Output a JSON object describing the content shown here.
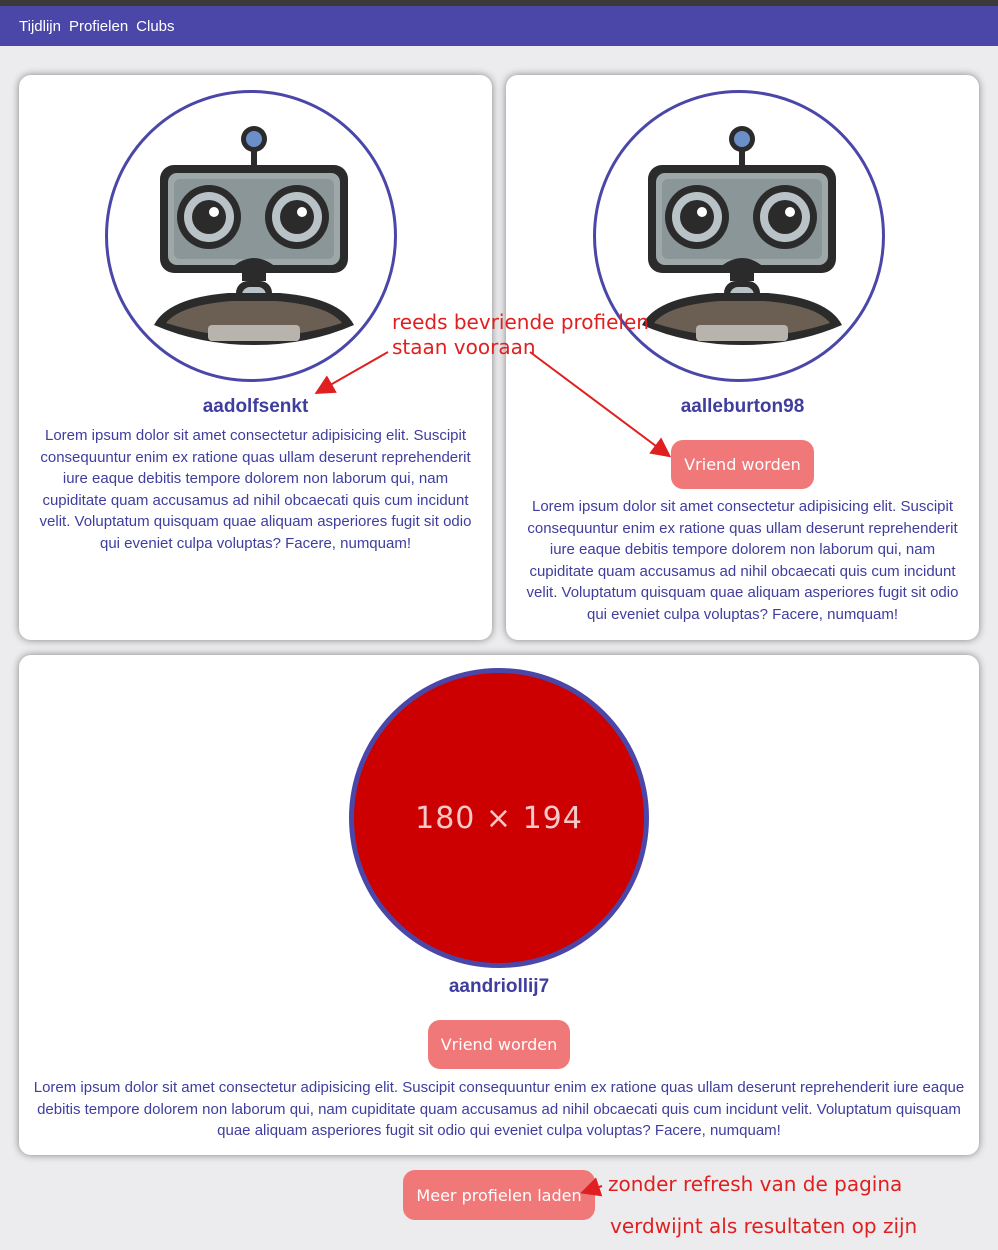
{
  "nav": {
    "items": [
      {
        "label": "Tijdlijn"
      },
      {
        "label": "Profielen"
      },
      {
        "label": "Clubs"
      }
    ]
  },
  "profiles": [
    {
      "username": "aadolfsenkt",
      "bio": "Lorem ipsum dolor sit amet consectetur adipisicing elit. Suscipit consequuntur enim ex ratione quas ullam deserunt reprehenderit iure eaque debitis tempore dolorem non laborum qui, nam cupiditate quam accusamus ad nihil obcaecati quis cum incidunt velit. Voluptatum quisquam quae aliquam asperiores fugit sit odio qui eveniet culpa voluptas? Facere, numquam!",
      "avatar_icon": "robot-icon"
    },
    {
      "username": "aalleburton98",
      "button_label": "Vriend worden",
      "bio": "Lorem ipsum dolor sit amet consectetur adipisicing elit. Suscipit consequuntur enim ex ratione quas ullam deserunt reprehenderit iure eaque debitis tempore dolorem non laborum qui, nam cupiditate quam accusamus ad nihil obcaecati quis cum incidunt velit. Voluptatum quisquam quae aliquam asperiores fugit sit odio qui eveniet culpa voluptas? Facere, numquam!",
      "avatar_icon": "robot-icon"
    },
    {
      "username": "aandriollij7",
      "button_label": "Vriend worden",
      "avatar_placeholder": "180 × 194",
      "bio": "Lorem ipsum dolor sit amet consectetur adipisicing elit. Suscipit consequuntur enim ex ratione quas ullam deserunt reprehenderit iure eaque debitis tempore dolorem non laborum qui, nam cupiditate quam accusamus ad nihil obcaecati quis cum incidunt velit. Voluptatum quisquam quae aliquam asperiores fugit sit odio qui eveniet culpa voluptas? Facere, numquam!"
    }
  ],
  "load_more": {
    "label": "Meer profielen laden"
  },
  "annotations": {
    "friends_first_line1": "reeds bevriende profielen",
    "friends_first_line2": "staan vooraan",
    "no_refresh": "zonder refresh van de pagina",
    "disappears": "verdwijnt als resultaten op zijn"
  },
  "colors": {
    "navbar": "#4a47a8",
    "accent_text": "#3f3d9e",
    "button": "#f07879",
    "annotation": "#e02020",
    "placeholder_fill": "#cc0000"
  }
}
